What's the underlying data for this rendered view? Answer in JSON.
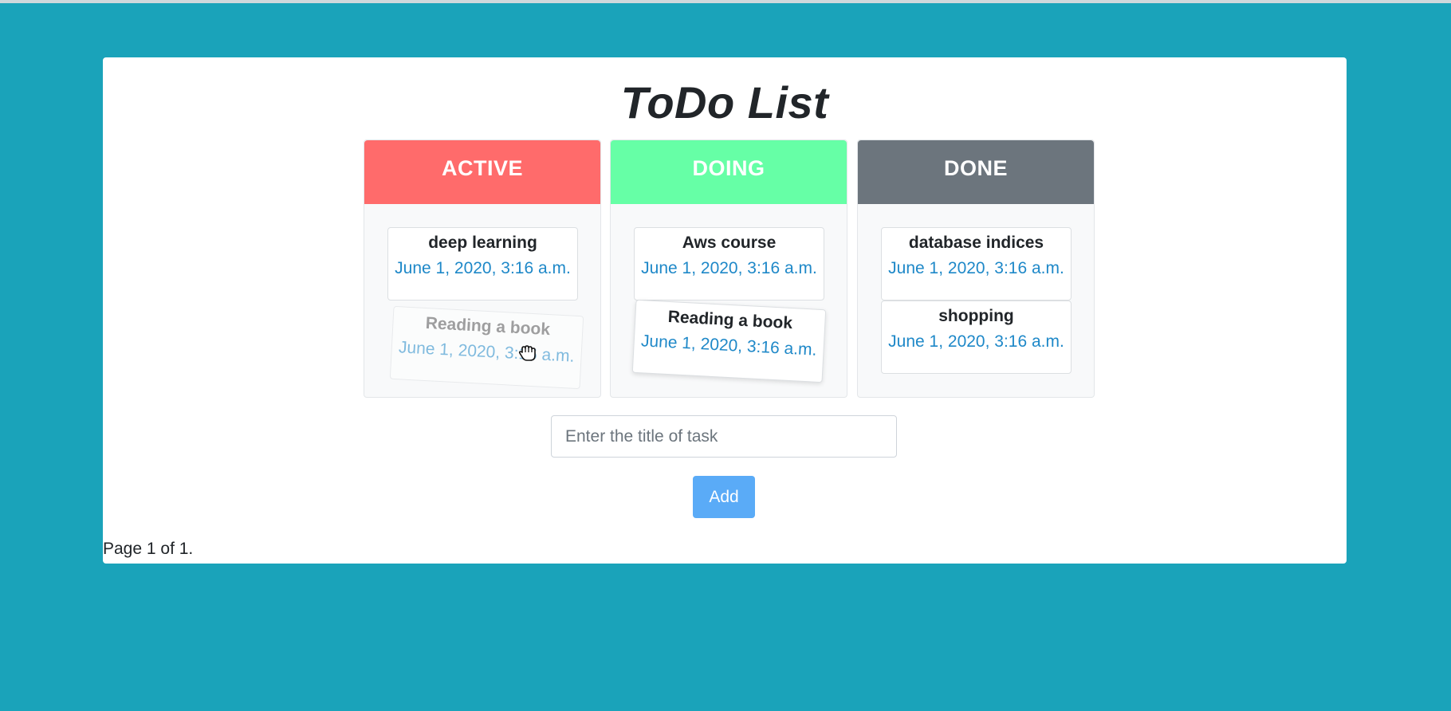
{
  "app": {
    "title": "ToDo List"
  },
  "columns": [
    {
      "header": "ACTIVE",
      "color": "#ff6b6b",
      "tasks": [
        {
          "title": "deep learning",
          "date": "June 1, 2020, 3:16 a.m."
        },
        {
          "title": "Reading a book",
          "date": "June 1, 2020, 3:16 a.m."
        }
      ]
    },
    {
      "header": "DOING",
      "color": "#66ffa6",
      "tasks": [
        {
          "title": "Aws course",
          "date": "June 1, 2020, 3:16 a.m."
        },
        {
          "title": "Reading a book",
          "date": "June 1, 2020, 3:16 a.m."
        }
      ]
    },
    {
      "header": "DONE",
      "color": "#6c757d",
      "tasks": [
        {
          "title": "database indices",
          "date": "June 1, 2020, 3:16 a.m."
        },
        {
          "title": "shopping",
          "date": "June 1, 2020, 3:16 a.m."
        }
      ]
    }
  ],
  "form": {
    "placeholder": "Enter the title of task",
    "value": "",
    "add_label": "Add"
  },
  "pagination": {
    "text": "Page 1 of 1."
  },
  "colors": {
    "background": "#1aa3ba",
    "date_text": "#1e88c8",
    "button": "#5aabf7"
  },
  "icons": {
    "cursor": "grab-hand-icon"
  }
}
